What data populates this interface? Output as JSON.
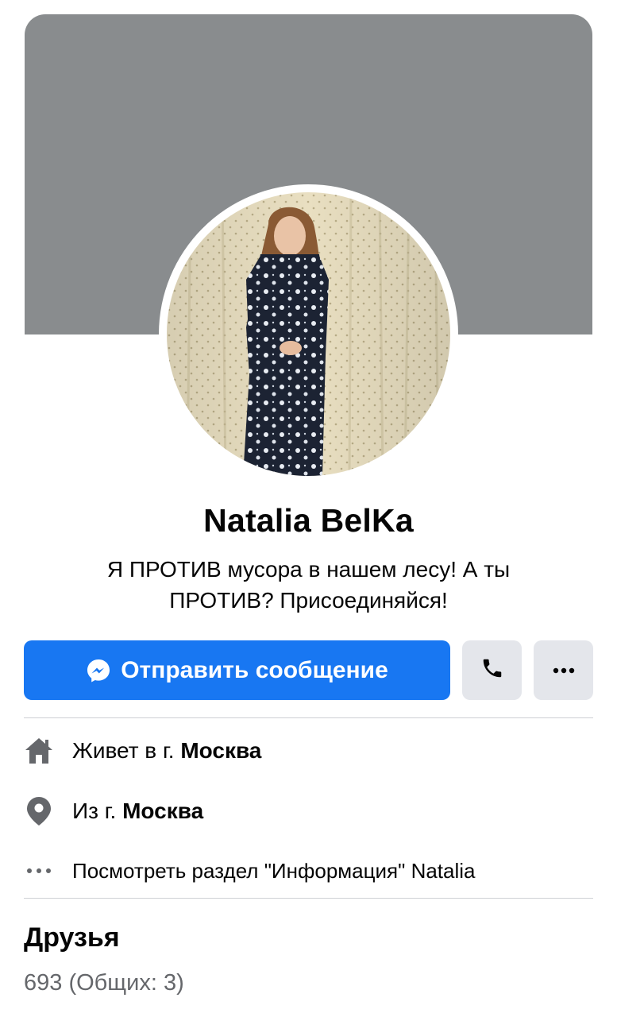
{
  "profile": {
    "name": "Natalia BelKa",
    "bio_line1": "Я ПРОТИВ мусора в нашем лесу! А ты",
    "bio_line2": "ПРОТИВ? Присоединяйся!"
  },
  "actions": {
    "message_label": "Отправить сообщение",
    "message_icon": "messenger-icon",
    "call_icon": "phone-icon",
    "more_icon": "more-dots-icon"
  },
  "info": {
    "lives_prefix": "Живет в г. ",
    "lives_city": "Москва",
    "from_prefix": "Из г. ",
    "from_city": "Москва",
    "about_link": "Посмотреть раздел \"Информация\" Natalia"
  },
  "friends": {
    "title": "Друзья",
    "count": "693 (Общих: 3)"
  },
  "colors": {
    "accent": "#1877f2",
    "cover": "#898c8e",
    "button_gray": "#e4e6eb",
    "secondary_text": "#65676b"
  }
}
